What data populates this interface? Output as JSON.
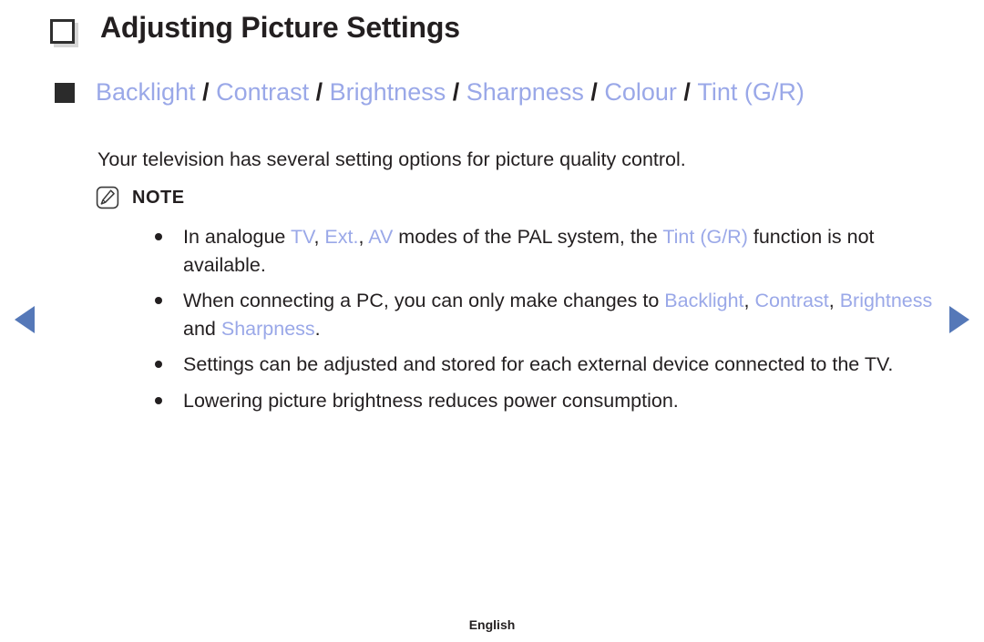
{
  "page": {
    "title": "Adjusting Picture Settings",
    "title_bullet_icon": "hollow-square-icon",
    "menu_bullet_icon": "filled-square-icon",
    "accent_color": "#9aa8e8",
    "arrow_color": "#5578b8",
    "text_color": "#231f20",
    "background_color": "#ffffff"
  },
  "menu_path": {
    "items": [
      "Backlight",
      "Contrast",
      "Brightness",
      "Sharpness",
      "Colour",
      "Tint (G/R)"
    ],
    "separator": "/"
  },
  "description": "Your television has several setting options for picture quality control.",
  "note": {
    "icon": "note-pencil-icon",
    "label": "NOTE",
    "items": [
      {
        "parts": [
          {
            "text": "In analogue ",
            "accent": false
          },
          {
            "text": "TV",
            "accent": true
          },
          {
            "text": ", ",
            "accent": false
          },
          {
            "text": "Ext.",
            "accent": true
          },
          {
            "text": ", ",
            "accent": false
          },
          {
            "text": "AV",
            "accent": true
          },
          {
            "text": " modes of the PAL system, the ",
            "accent": false
          },
          {
            "text": "Tint (G/R)",
            "accent": true
          },
          {
            "text": " function is not available.",
            "accent": false
          }
        ]
      },
      {
        "parts": [
          {
            "text": "When connecting a PC, you can only make changes to ",
            "accent": false
          },
          {
            "text": "Backlight",
            "accent": true
          },
          {
            "text": ", ",
            "accent": false
          },
          {
            "text": "Contrast",
            "accent": true
          },
          {
            "text": ", ",
            "accent": false
          },
          {
            "text": "Brightness",
            "accent": true
          },
          {
            "text": " and ",
            "accent": false
          },
          {
            "text": "Sharpness",
            "accent": true
          },
          {
            "text": ".",
            "accent": false
          }
        ]
      },
      {
        "parts": [
          {
            "text": "Settings can be adjusted and stored for each external device connected to the TV.",
            "accent": false
          }
        ]
      },
      {
        "parts": [
          {
            "text": "Lowering picture brightness reduces power consumption.",
            "accent": false
          }
        ]
      }
    ]
  },
  "navigation": {
    "prev_icon": "triangle-left-icon",
    "next_icon": "triangle-right-icon"
  },
  "footer": {
    "language": "English"
  }
}
